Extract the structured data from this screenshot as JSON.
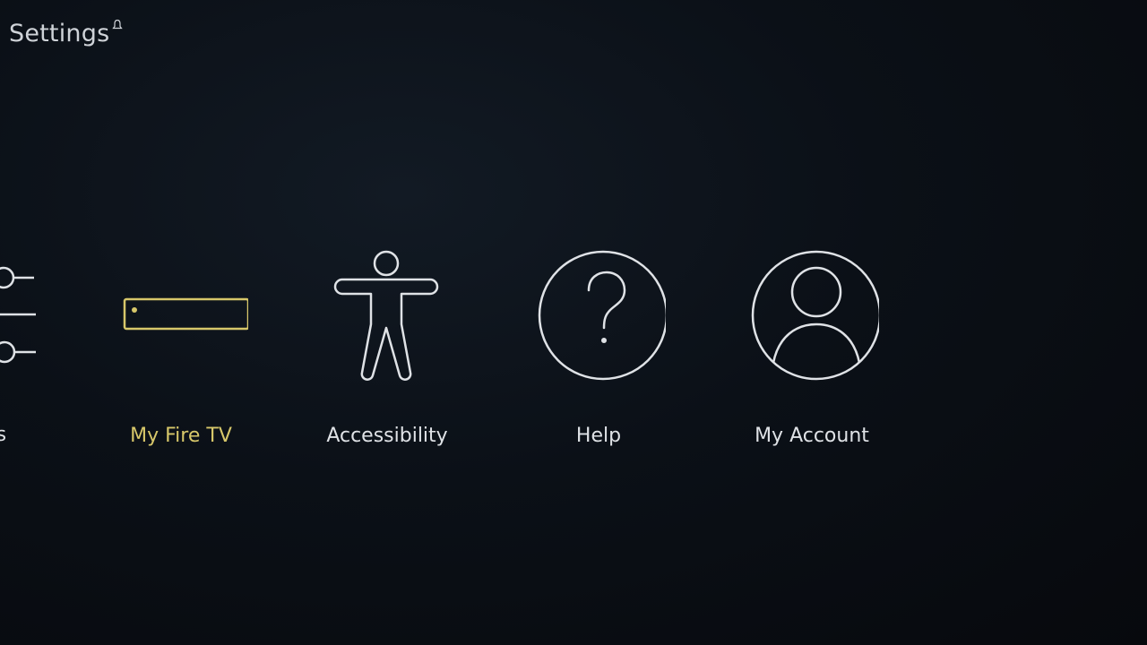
{
  "header": {
    "title": "Settings",
    "notification_icon": "bell-icon"
  },
  "colors": {
    "focus_accent": "#d7c76a",
    "icon_stroke": "#dfe2e6",
    "background": "#0b1017"
  },
  "menu": {
    "items": [
      {
        "label": "nces",
        "icon": "sliders-icon",
        "focused": false
      },
      {
        "label": "My Fire TV",
        "icon": "fire-tv-device-icon",
        "focused": true
      },
      {
        "label": "Accessibility",
        "icon": "accessibility-icon",
        "focused": false
      },
      {
        "label": "Help",
        "icon": "help-icon",
        "focused": false
      },
      {
        "label": "My Account",
        "icon": "account-icon",
        "focused": false
      }
    ]
  }
}
